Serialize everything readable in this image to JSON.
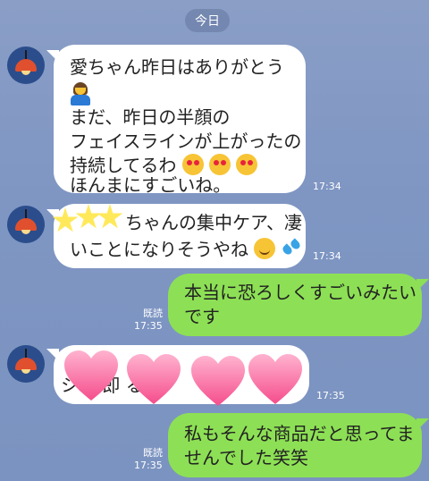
{
  "date_label": "今日",
  "messages": [
    {
      "lines": [
        "愛ちゃん昨日はありがとう",
        "",
        "まだ、昨日の半顔の",
        "フェイスラインが上がったの",
        "持続してるわ",
        "ほんまにすごいね。"
      ],
      "time": "17:34"
    },
    {
      "lines": [
        "ちゃんの集中ケア、凄",
        "いことになりそうやね"
      ],
      "time": "17:34"
    },
    {
      "lines": [
        "本当に恐ろしくすごいみたい",
        "です"
      ],
      "read": "既読",
      "time": "17:35"
    },
    {
      "lines": [
        "シ で即 るの"
      ],
      "time": "17:35"
    },
    {
      "lines": [
        "私もそんな商品だと思ってま",
        "せんでした笑笑"
      ],
      "read": "既読",
      "time": "17:35"
    }
  ],
  "icons": {
    "avatar": "red-lamp-avatar-icon",
    "bow": "person-bowing-icon",
    "heart_eyes": "smiling-face-with-heart-eyes-icon",
    "sweat_smile": "grinning-face-with-sweat-icon",
    "drops": "sweat-droplets-icon",
    "stars": "star-icon",
    "hearts": "pink-heart-icon"
  },
  "colors": {
    "background": "#7f96c3",
    "incoming_bubble": "#ffffff",
    "outgoing_bubble": "#8de055",
    "text": "#222222"
  }
}
